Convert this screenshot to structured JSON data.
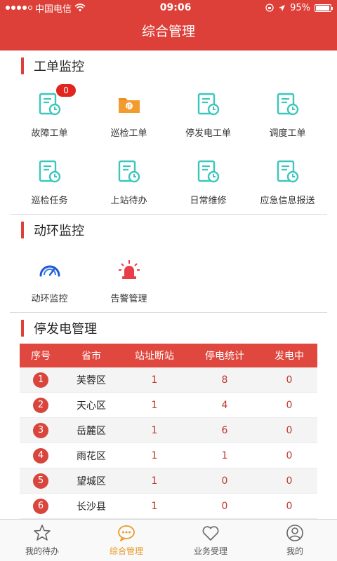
{
  "status_bar": {
    "carrier": "中国电信",
    "time": "09:06",
    "battery": "95%"
  },
  "header": {
    "title": "综合管理"
  },
  "section_work_orders": {
    "title": "工单监控",
    "items": [
      {
        "label": "故障工单",
        "badge": "0"
      },
      {
        "label": "巡检工单"
      },
      {
        "label": "停发电工单"
      },
      {
        "label": "调度工单"
      },
      {
        "label": "巡检任务"
      },
      {
        "label": "上站待办"
      },
      {
        "label": "日常维修"
      },
      {
        "label": "应急信息报送"
      }
    ]
  },
  "section_env": {
    "title": "动环监控",
    "items": [
      {
        "label": "动环监控"
      },
      {
        "label": "告警管理"
      }
    ]
  },
  "section_power": {
    "title": "停发电管理",
    "columns": [
      "序号",
      "省市",
      "站址断站",
      "停电统计",
      "发电中"
    ],
    "rows": [
      {
        "no": "1",
        "city": "芙蓉区",
        "sites_down": "1",
        "outages": "8",
        "generating": "0"
      },
      {
        "no": "2",
        "city": "天心区",
        "sites_down": "1",
        "outages": "4",
        "generating": "0"
      },
      {
        "no": "3",
        "city": "岳麓区",
        "sites_down": "1",
        "outages": "6",
        "generating": "0"
      },
      {
        "no": "4",
        "city": "雨花区",
        "sites_down": "1",
        "outages": "1",
        "generating": "0"
      },
      {
        "no": "5",
        "city": "望城区",
        "sites_down": "1",
        "outages": "0",
        "generating": "0"
      },
      {
        "no": "6",
        "city": "长沙县",
        "sites_down": "1",
        "outages": "0",
        "generating": "0"
      }
    ]
  },
  "tabbar": {
    "tabs": [
      {
        "label": "我的待办",
        "icon": "star-icon"
      },
      {
        "label": "综合管理",
        "icon": "chat-icon",
        "active": true
      },
      {
        "label": "业务受理",
        "icon": "heart-icon"
      },
      {
        "label": "我的",
        "icon": "user-icon"
      }
    ]
  },
  "colors": {
    "primary": "#dd4038",
    "active_tab": "#e89a2a",
    "icon_teal": "#3cc6bd",
    "icon_orange": "#f08c1a",
    "icon_blue": "#1e5bd6"
  }
}
